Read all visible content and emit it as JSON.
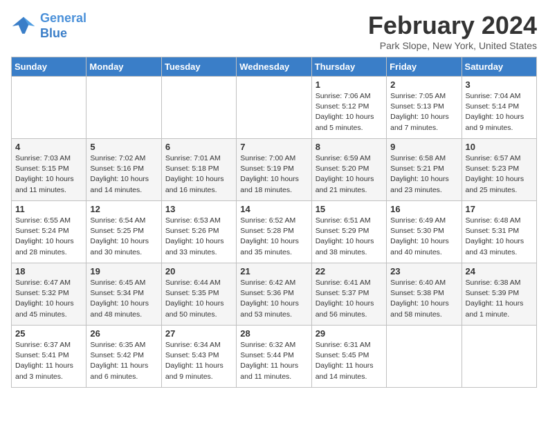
{
  "logo": {
    "line1": "General",
    "line2": "Blue"
  },
  "title": "February 2024",
  "subtitle": "Park Slope, New York, United States",
  "days_of_week": [
    "Sunday",
    "Monday",
    "Tuesday",
    "Wednesday",
    "Thursday",
    "Friday",
    "Saturday"
  ],
  "weeks": [
    [
      {
        "day": "",
        "info": ""
      },
      {
        "day": "",
        "info": ""
      },
      {
        "day": "",
        "info": ""
      },
      {
        "day": "",
        "info": ""
      },
      {
        "day": "1",
        "info": "Sunrise: 7:06 AM\nSunset: 5:12 PM\nDaylight: 10 hours\nand 5 minutes."
      },
      {
        "day": "2",
        "info": "Sunrise: 7:05 AM\nSunset: 5:13 PM\nDaylight: 10 hours\nand 7 minutes."
      },
      {
        "day": "3",
        "info": "Sunrise: 7:04 AM\nSunset: 5:14 PM\nDaylight: 10 hours\nand 9 minutes."
      }
    ],
    [
      {
        "day": "4",
        "info": "Sunrise: 7:03 AM\nSunset: 5:15 PM\nDaylight: 10 hours\nand 11 minutes."
      },
      {
        "day": "5",
        "info": "Sunrise: 7:02 AM\nSunset: 5:16 PM\nDaylight: 10 hours\nand 14 minutes."
      },
      {
        "day": "6",
        "info": "Sunrise: 7:01 AM\nSunset: 5:18 PM\nDaylight: 10 hours\nand 16 minutes."
      },
      {
        "day": "7",
        "info": "Sunrise: 7:00 AM\nSunset: 5:19 PM\nDaylight: 10 hours\nand 18 minutes."
      },
      {
        "day": "8",
        "info": "Sunrise: 6:59 AM\nSunset: 5:20 PM\nDaylight: 10 hours\nand 21 minutes."
      },
      {
        "day": "9",
        "info": "Sunrise: 6:58 AM\nSunset: 5:21 PM\nDaylight: 10 hours\nand 23 minutes."
      },
      {
        "day": "10",
        "info": "Sunrise: 6:57 AM\nSunset: 5:23 PM\nDaylight: 10 hours\nand 25 minutes."
      }
    ],
    [
      {
        "day": "11",
        "info": "Sunrise: 6:55 AM\nSunset: 5:24 PM\nDaylight: 10 hours\nand 28 minutes."
      },
      {
        "day": "12",
        "info": "Sunrise: 6:54 AM\nSunset: 5:25 PM\nDaylight: 10 hours\nand 30 minutes."
      },
      {
        "day": "13",
        "info": "Sunrise: 6:53 AM\nSunset: 5:26 PM\nDaylight: 10 hours\nand 33 minutes."
      },
      {
        "day": "14",
        "info": "Sunrise: 6:52 AM\nSunset: 5:28 PM\nDaylight: 10 hours\nand 35 minutes."
      },
      {
        "day": "15",
        "info": "Sunrise: 6:51 AM\nSunset: 5:29 PM\nDaylight: 10 hours\nand 38 minutes."
      },
      {
        "day": "16",
        "info": "Sunrise: 6:49 AM\nSunset: 5:30 PM\nDaylight: 10 hours\nand 40 minutes."
      },
      {
        "day": "17",
        "info": "Sunrise: 6:48 AM\nSunset: 5:31 PM\nDaylight: 10 hours\nand 43 minutes."
      }
    ],
    [
      {
        "day": "18",
        "info": "Sunrise: 6:47 AM\nSunset: 5:32 PM\nDaylight: 10 hours\nand 45 minutes."
      },
      {
        "day": "19",
        "info": "Sunrise: 6:45 AM\nSunset: 5:34 PM\nDaylight: 10 hours\nand 48 minutes."
      },
      {
        "day": "20",
        "info": "Sunrise: 6:44 AM\nSunset: 5:35 PM\nDaylight: 10 hours\nand 50 minutes."
      },
      {
        "day": "21",
        "info": "Sunrise: 6:42 AM\nSunset: 5:36 PM\nDaylight: 10 hours\nand 53 minutes."
      },
      {
        "day": "22",
        "info": "Sunrise: 6:41 AM\nSunset: 5:37 PM\nDaylight: 10 hours\nand 56 minutes."
      },
      {
        "day": "23",
        "info": "Sunrise: 6:40 AM\nSunset: 5:38 PM\nDaylight: 10 hours\nand 58 minutes."
      },
      {
        "day": "24",
        "info": "Sunrise: 6:38 AM\nSunset: 5:39 PM\nDaylight: 11 hours\nand 1 minute."
      }
    ],
    [
      {
        "day": "25",
        "info": "Sunrise: 6:37 AM\nSunset: 5:41 PM\nDaylight: 11 hours\nand 3 minutes."
      },
      {
        "day": "26",
        "info": "Sunrise: 6:35 AM\nSunset: 5:42 PM\nDaylight: 11 hours\nand 6 minutes."
      },
      {
        "day": "27",
        "info": "Sunrise: 6:34 AM\nSunset: 5:43 PM\nDaylight: 11 hours\nand 9 minutes."
      },
      {
        "day": "28",
        "info": "Sunrise: 6:32 AM\nSunset: 5:44 PM\nDaylight: 11 hours\nand 11 minutes."
      },
      {
        "day": "29",
        "info": "Sunrise: 6:31 AM\nSunset: 5:45 PM\nDaylight: 11 hours\nand 14 minutes."
      },
      {
        "day": "",
        "info": ""
      },
      {
        "day": "",
        "info": ""
      }
    ]
  ]
}
